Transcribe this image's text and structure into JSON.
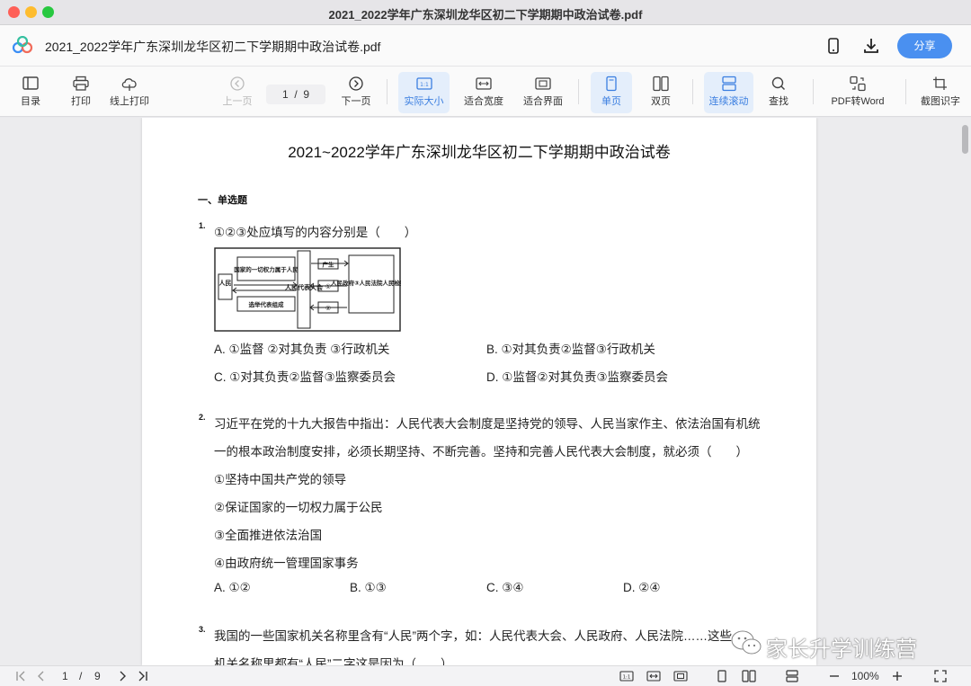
{
  "window": {
    "title": "2021_2022学年广东深圳龙华区初二下学期期中政治试卷.pdf"
  },
  "header": {
    "doc_name": "2021_2022学年广东深圳龙华区初二下学期期中政治试卷.pdf",
    "share_label": "分享",
    "accent": "#4a90f0"
  },
  "toolbar": {
    "toc": "目录",
    "print": "打印",
    "online_print": "线上打印",
    "prev_page": "上一页",
    "page_current": "1",
    "page_sep": "/",
    "page_total": "9",
    "next_page": "下一页",
    "actual_size": "实际大小",
    "fit_width": "适合宽度",
    "fit_page": "适合界面",
    "single_page": "单页",
    "double_page": "双页",
    "continuous": "连续滚动",
    "find": "查找",
    "pdf_to_word": "PDF转Word",
    "ocr": "截图识字"
  },
  "document": {
    "title": "2021~2022学年广东深圳龙华区初二下学期期中政治试卷",
    "section": "一、单选题",
    "q1": {
      "num": "1.",
      "text": "①②③处应填写的内容分别是（　　）",
      "figure": {
        "left_box": "人民",
        "top_box": "国家的一切权力属于人民",
        "bottom_box": "选举代表组成",
        "middle_box": "人民代表大会",
        "produce": "产生",
        "c1": "①",
        "c2": "②",
        "right_box": "人民政府③人民法院人民检察院"
      },
      "options": {
        "a": "A. ①监督 ②对其负责 ③行政机关",
        "b": "B. ①对其负责②监督③行政机关",
        "c": "C. ①对其负责②监督③监察委员会",
        "d": "D. ①监督②对其负责③监察委员会"
      }
    },
    "q2": {
      "num": "2.",
      "line1": "习近平在党的十九大报告中指出：人民代表大会制度是坚持党的领导、人民当家作主、依法治国有机统",
      "line2": "一的根本政治制度安排，必须长期坚持、不断完善。坚持和完善人民代表大会制度，就必须（　　）",
      "s1": "①坚持中国共产党的领导",
      "s2": "②保证国家的一切权力属于公民",
      "s3": "③全面推进依法治国",
      "s4": "④由政府统一管理国家事务",
      "options": {
        "a": "A. ①②",
        "b": "B. ①③",
        "c": "C. ③④",
        "d": "D. ②④"
      }
    },
    "q3": {
      "num": "3.",
      "line1": "我国的一些国家机关名称里含有“人民”两个字，如：人民代表大会、人民政府、人民法院……这些",
      "line2": "机关名称里都有“人民”二字这是因为（　　）"
    }
  },
  "watermark": "家长升学训练营",
  "statusbar": {
    "page_current": "1",
    "page_sep": "/",
    "page_total": "9",
    "zoom": "100%"
  }
}
